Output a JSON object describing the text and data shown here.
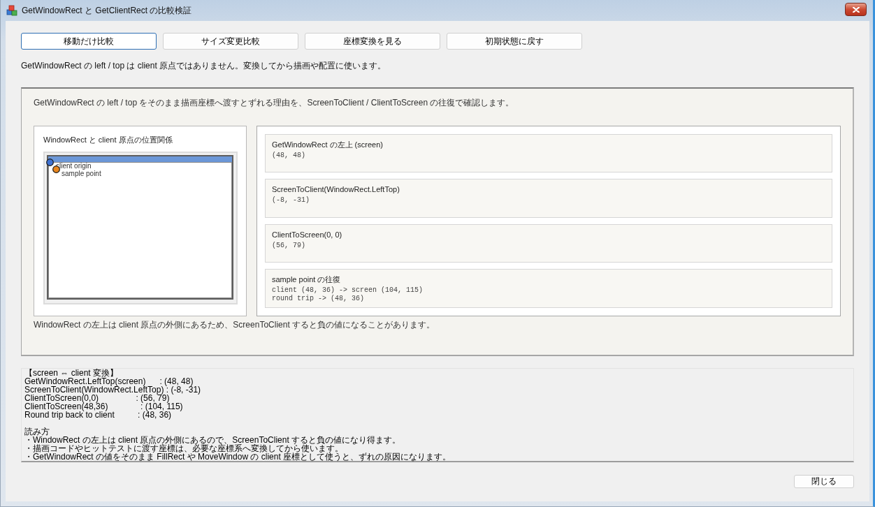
{
  "window": {
    "title": "GetWindowRect と GetClientRect の比較検証"
  },
  "mode_buttons": [
    {
      "label": "移動だけ比較",
      "selected": true
    },
    {
      "label": "サイズ変更比較",
      "selected": false
    },
    {
      "label": "座標変換を見る",
      "selected": false
    },
    {
      "label": "初期状態に戻す",
      "selected": false
    }
  ],
  "hint": "GetWindowRect の left / top は client 原点ではありません。変換してから描画や配置に使います。",
  "panel": {
    "description": "GetWindowRect の left / top をそのまま描画座標へ渡すとずれる理由を、ScreenToClient / ClientToScreen の往復で確認します。",
    "diagram": {
      "title": "WindowRect と client 原点の位置関係",
      "markers": [
        {
          "label": "client origin",
          "color": "#3f72d2"
        },
        {
          "label": "sample point",
          "color": "#e8861e"
        }
      ]
    },
    "cards": [
      {
        "title": "GetWindowRect の左上 (screen)",
        "lines": [
          "(48, 48)"
        ]
      },
      {
        "title": "ScreenToClient(WindowRect.LeftTop)",
        "lines": [
          "(-8, -31)"
        ]
      },
      {
        "title": "ClientToScreen(0, 0)",
        "lines": [
          "(56, 79)"
        ]
      },
      {
        "title": "sample point の往復",
        "lines": [
          "client (48, 36) -> screen (104, 115)",
          "round trip -> (48, 36)"
        ]
      }
    ],
    "footnote": "WindowRect の左上は client 原点の外側にあるため、ScreenToClient すると負の値になることがあります。"
  },
  "report": {
    "heading": "【screen ⇔ client 変換】",
    "rows": [
      "GetWindowRect.LeftTop(screen)      : (48, 48)",
      "ScreenToClient(WindowRect.LeftTop) : (-8, -31)",
      "ClientToScreen(0,0)                : (56, 79)",
      "ClientToScreen(48,36)              : (104, 115)",
      "Round trip back to client          : (48, 36)"
    ],
    "notes_title": "読み方",
    "notes": [
      "・WindowRect の左上は client 原点の外側にあるので、ScreenToClient すると負の値になり得ます。",
      "・描画コードやヒットテストに渡す座標は、必要な座標系へ変換してから使います。",
      "・GetWindowRect の値をそのまま FillRect や MoveWindow の client 座標として使うと、ずれの原因になります。"
    ]
  },
  "close_button": "閉じる"
}
